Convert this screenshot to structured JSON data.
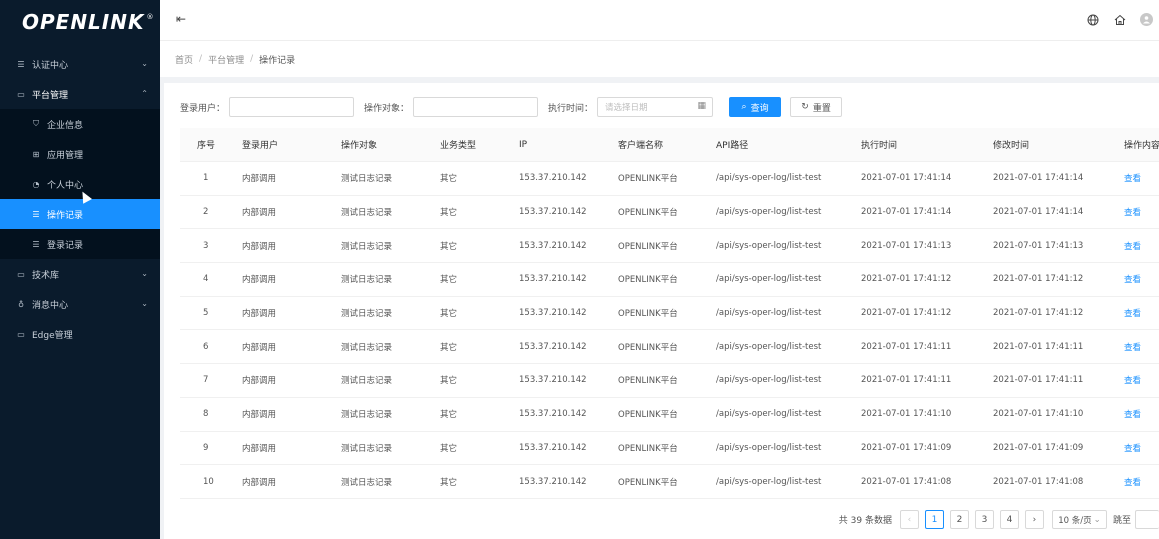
{
  "app": {
    "logo_text": "OPENLINK",
    "logo_mark": "®"
  },
  "sidebar": {
    "items": [
      {
        "label": "认证中心",
        "icon": "list-icon"
      },
      {
        "label": "平台管理",
        "icon": "monitor-icon"
      },
      {
        "label": "技术库",
        "icon": "monitor-icon"
      },
      {
        "label": "消息中心",
        "icon": "network-icon"
      },
      {
        "label": "Edge管理",
        "icon": "monitor-icon"
      }
    ],
    "submenu": [
      {
        "label": "企业信息",
        "icon": "shield-icon"
      },
      {
        "label": "应用管理",
        "icon": "grid-icon"
      },
      {
        "label": "个人中心",
        "icon": "user-circle-icon"
      },
      {
        "label": "操作记录",
        "icon": "list-icon"
      },
      {
        "label": "登录记录",
        "icon": "list-icon"
      }
    ],
    "active_item": "操作记录"
  },
  "breadcrumb": {
    "items": [
      "首页",
      "平台管理",
      "操作记录"
    ]
  },
  "filters": {
    "user_label": "登录用户：",
    "object_label": "操作对象：",
    "time_label": "执行时间：",
    "date_placeholder": "请选择日期",
    "search_label": "查询",
    "reset_label": "重置"
  },
  "table": {
    "headers": [
      "序号",
      "登录用户",
      "操作对象",
      "业务类型",
      "IP",
      "客户端名称",
      "API路径",
      "执行时间",
      "修改时间",
      "操作内容"
    ],
    "rows": [
      [
        "1",
        "内部调用",
        "测试日志记录",
        "其它",
        "153.37.210.142",
        "OPENLINK平台",
        "/api/sys-oper-log/list-test",
        "2021-07-01 17:41:14",
        "2021-07-01 17:41:14",
        "查看"
      ],
      [
        "2",
        "内部调用",
        "测试日志记录",
        "其它",
        "153.37.210.142",
        "OPENLINK平台",
        "/api/sys-oper-log/list-test",
        "2021-07-01 17:41:14",
        "2021-07-01 17:41:14",
        "查看"
      ],
      [
        "3",
        "内部调用",
        "测试日志记录",
        "其它",
        "153.37.210.142",
        "OPENLINK平台",
        "/api/sys-oper-log/list-test",
        "2021-07-01 17:41:13",
        "2021-07-01 17:41:13",
        "查看"
      ],
      [
        "4",
        "内部调用",
        "测试日志记录",
        "其它",
        "153.37.210.142",
        "OPENLINK平台",
        "/api/sys-oper-log/list-test",
        "2021-07-01 17:41:12",
        "2021-07-01 17:41:12",
        "查看"
      ],
      [
        "5",
        "内部调用",
        "测试日志记录",
        "其它",
        "153.37.210.142",
        "OPENLINK平台",
        "/api/sys-oper-log/list-test",
        "2021-07-01 17:41:12",
        "2021-07-01 17:41:12",
        "查看"
      ],
      [
        "6",
        "内部调用",
        "测试日志记录",
        "其它",
        "153.37.210.142",
        "OPENLINK平台",
        "/api/sys-oper-log/list-test",
        "2021-07-01 17:41:11",
        "2021-07-01 17:41:11",
        "查看"
      ],
      [
        "7",
        "内部调用",
        "测试日志记录",
        "其它",
        "153.37.210.142",
        "OPENLINK平台",
        "/api/sys-oper-log/list-test",
        "2021-07-01 17:41:11",
        "2021-07-01 17:41:11",
        "查看"
      ],
      [
        "8",
        "内部调用",
        "测试日志记录",
        "其它",
        "153.37.210.142",
        "OPENLINK平台",
        "/api/sys-oper-log/list-test",
        "2021-07-01 17:41:10",
        "2021-07-01 17:41:10",
        "查看"
      ],
      [
        "9",
        "内部调用",
        "测试日志记录",
        "其它",
        "153.37.210.142",
        "OPENLINK平台",
        "/api/sys-oper-log/list-test",
        "2021-07-01 17:41:09",
        "2021-07-01 17:41:09",
        "查看"
      ],
      [
        "10",
        "内部调用",
        "测试日志记录",
        "其它",
        "153.37.210.142",
        "OPENLINK平台",
        "/api/sys-oper-log/list-test",
        "2021-07-01 17:41:08",
        "2021-07-01 17:41:08",
        "查看"
      ]
    ]
  },
  "pagination": {
    "total_text": "共 39 条数据",
    "pages": [
      "1",
      "2",
      "3",
      "4"
    ],
    "current_page": "1",
    "page_size": "10 条/页",
    "jump_label": "跳至"
  },
  "colors": {
    "sidebar_bg": "#0a1b2c",
    "accent": "#1890ff"
  }
}
